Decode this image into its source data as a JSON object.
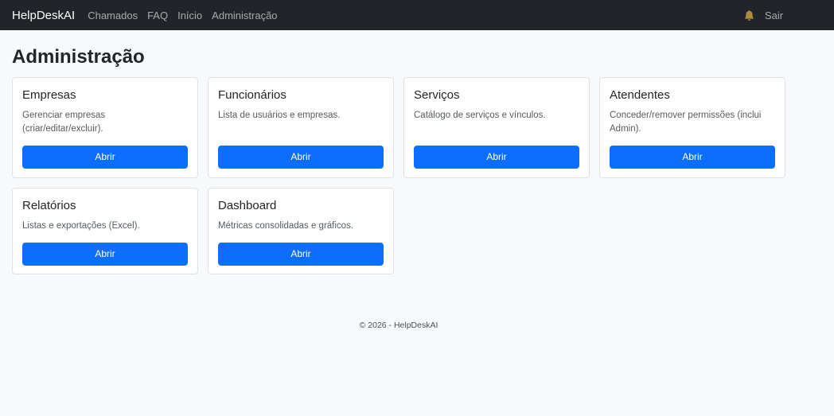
{
  "navbar": {
    "brand": "HelpDeskAI",
    "links": [
      "Chamados",
      "FAQ",
      "Início",
      "Administração"
    ],
    "bell_icon": "bell-icon",
    "bell_color": "#b08a3c",
    "logout_label": "Sair"
  },
  "page": {
    "title": "Administração"
  },
  "cards": [
    {
      "title": "Empresas",
      "text": "Gerenciar empresas (criar/editar/excluir).",
      "button": "Abrir"
    },
    {
      "title": "Funcionários",
      "text": "Lista de usuários e empresas.",
      "button": "Abrir"
    },
    {
      "title": "Serviços",
      "text": "Catálogo de serviços e vínculos.",
      "button": "Abrir"
    },
    {
      "title": "Atendentes",
      "text": "Conceder/remover permissões (inclui Admin).",
      "button": "Abrir"
    },
    {
      "title": "Relatórios",
      "text": "Listas e exportações (Excel).",
      "button": "Abrir"
    },
    {
      "title": "Dashboard",
      "text": "Métricas consolidadas e gráficos.",
      "button": "Abrir"
    }
  ],
  "footer": {
    "text": "© 2026 - HelpDeskAI"
  },
  "colors": {
    "navbar_bg": "#212529",
    "primary": "#0d6efd",
    "page_bg": "#f8f9fa"
  }
}
